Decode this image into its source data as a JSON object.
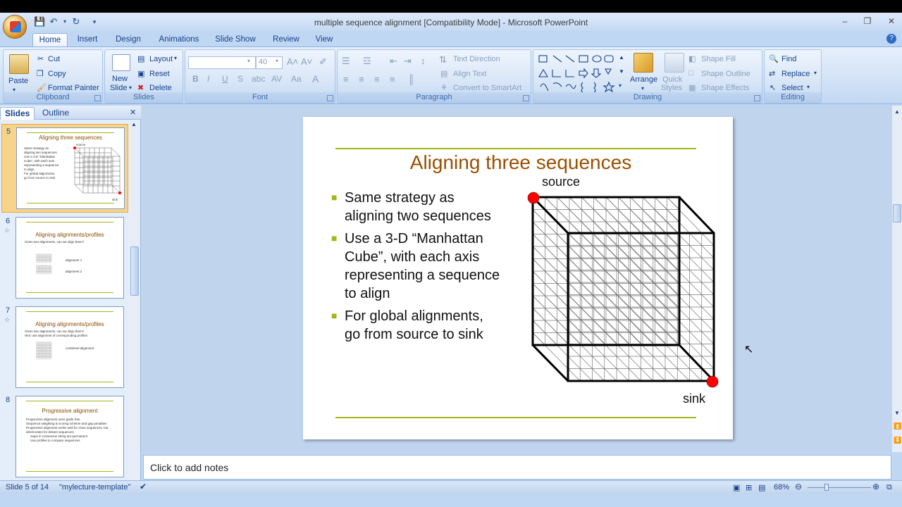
{
  "window": {
    "title": "multiple sequence alignment [Compatibility Mode] - Microsoft PowerPoint"
  },
  "tabs": [
    "Home",
    "Insert",
    "Design",
    "Animations",
    "Slide Show",
    "Review",
    "View"
  ],
  "ribbon": {
    "clipboard": {
      "label": "Clipboard",
      "paste": "Paste",
      "cut": "Cut",
      "copy": "Copy",
      "format_painter": "Format Painter"
    },
    "slides": {
      "label": "Slides",
      "new_slide_1": "New",
      "new_slide_2": "Slide",
      "layout": "Layout",
      "reset": "Reset",
      "delete": "Delete"
    },
    "font": {
      "label": "Font",
      "size": "40"
    },
    "paragraph": {
      "label": "Paragraph",
      "text_direction": "Text Direction",
      "align_text": "Align Text",
      "convert_smartart": "Convert to SmartArt"
    },
    "drawing": {
      "label": "Drawing",
      "arrange": "Arrange",
      "quick_styles_1": "Quick",
      "quick_styles_2": "Styles",
      "shape_fill": "Shape Fill",
      "shape_outline": "Shape Outline",
      "shape_effects": "Shape Effects"
    },
    "editing": {
      "label": "Editing",
      "find": "Find",
      "replace": "Replace",
      "select": "Select"
    }
  },
  "panel": {
    "tab_slides": "Slides",
    "tab_outline": "Outline",
    "thumbnails": [
      {
        "num": "5",
        "title": "Aligning three sequences",
        "lines": [
          "Same strategy as",
          "aligning two sequences",
          "Use a 3-D “Manhattan",
          "Cube”, with each axis",
          "representing a sequence",
          "to align",
          "For global alignments,",
          "go from source to sink"
        ],
        "source": "source",
        "sink": "sink"
      },
      {
        "num": "6",
        "title": "Aligning alignments/profiles",
        "lines": [
          "Given two alignments, can we align them?"
        ],
        "extra": [
          "alignment 1",
          "alignment 2"
        ]
      },
      {
        "num": "7",
        "title": "Aligning alignments/profiles",
        "lines": [
          "Given two alignments, can we align them?",
          "Hint: use alignment of corresponding profiles"
        ],
        "extra": [
          "combined alignment"
        ]
      },
      {
        "num": "8",
        "title": "Progressive alignment",
        "lines": [
          "Progressive alignment uses guide tree",
          "Sequence weighting & scoring scheme and gap penalties",
          "Progressive alignment works well for close sequences, but deteriorates for distant sequences",
          "Gaps in consensus string are permanent",
          "Use profiles to compare sequences"
        ]
      }
    ]
  },
  "slide": {
    "title": "Aligning three sequences",
    "bullets": [
      {
        "lines": [
          "Same strategy as",
          "aligning two sequences"
        ]
      },
      {
        "lines": [
          "Use a 3-D “Manhattan",
          "Cube”, with each axis",
          "representing a sequence",
          "to align"
        ]
      },
      {
        "lines": [
          "For global alignments,",
          "go from source to sink"
        ]
      }
    ],
    "label_source": "source",
    "label_sink": "sink"
  },
  "notes": {
    "placeholder": "Click to add notes"
  },
  "status": {
    "slide_count": "Slide 5 of 14",
    "template": "\"mylecture-template\"",
    "zoom": "68%"
  },
  "colors": {
    "title": "#9b4f00",
    "rule": "#a4b617",
    "node": "#ff0000"
  }
}
